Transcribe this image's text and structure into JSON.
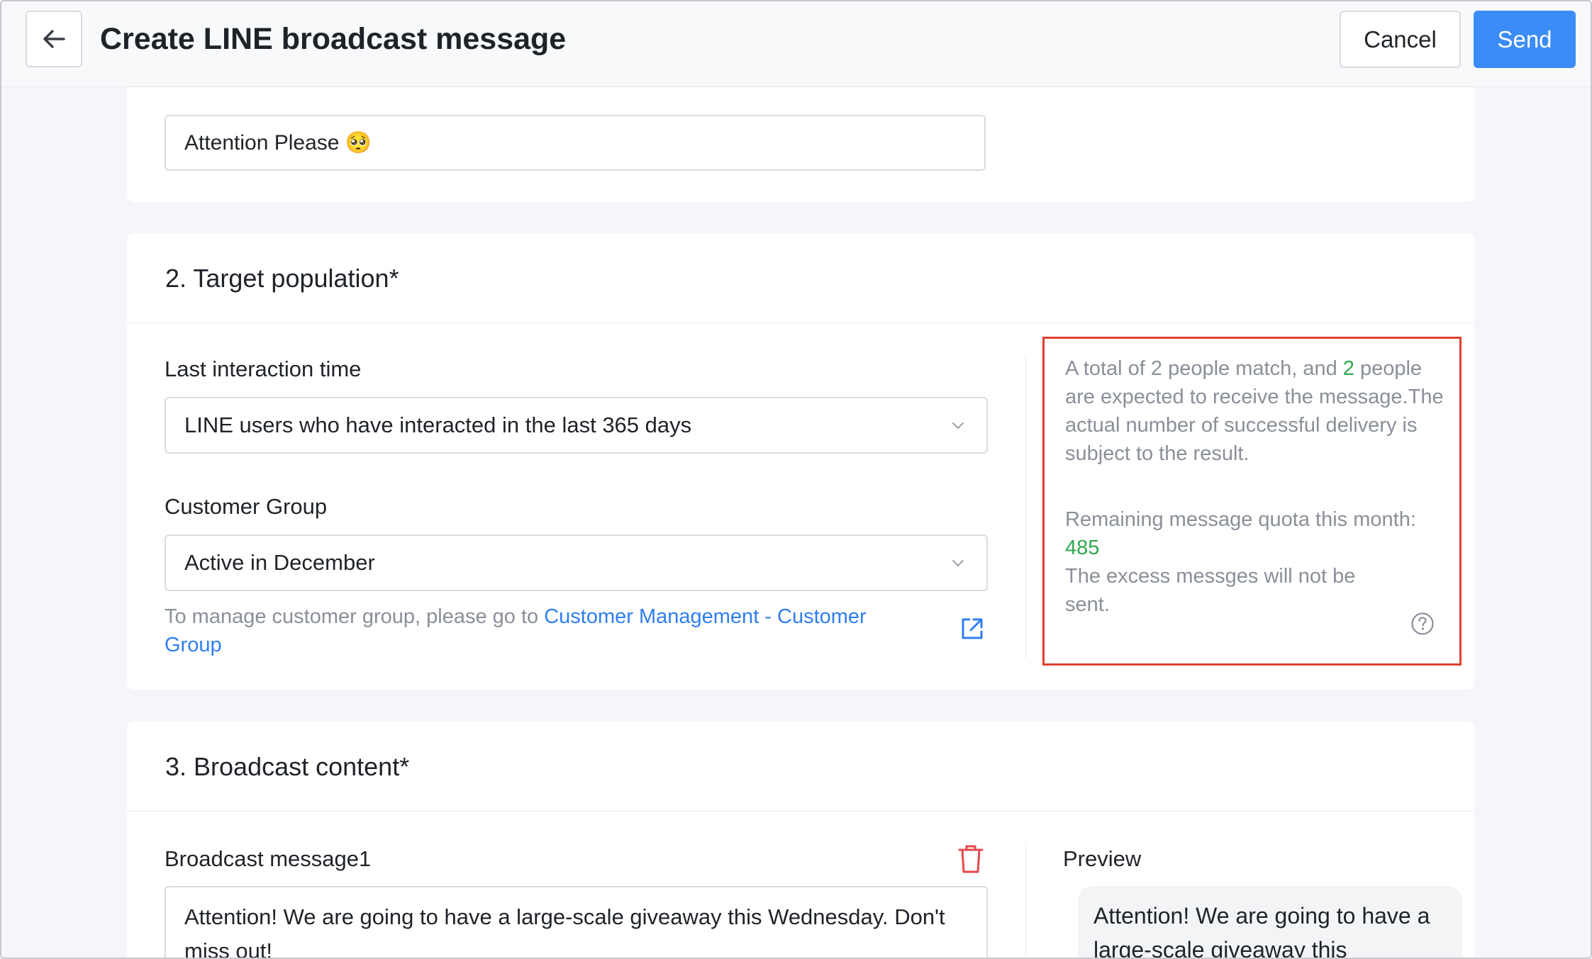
{
  "header": {
    "title": "Create LINE broadcast message",
    "cancel_label": "Cancel",
    "send_label": "Send"
  },
  "section1": {
    "title_value": "Attention Please 🥺"
  },
  "section2": {
    "title": "2. Target population*",
    "last_interaction_label": "Last interaction time",
    "last_interaction_value": "LINE users who have interacted in the last 365 days",
    "customer_group_label": "Customer Group",
    "customer_group_value": "Active in December",
    "hint_prefix": "To manage customer group, please go to ",
    "hint_link": "Customer Management - Customer Group",
    "info": {
      "match_prefix": "A total of 2 people match, and ",
      "expected_count": "2",
      "match_suffix": " people are expected to receive the message.The actual number of successful delivery is subject to the result.",
      "quota_label": "Remaining message quota this month:",
      "quota_value": "485",
      "excess_note": "The excess messges will not be sent."
    }
  },
  "section3": {
    "title": "3. Broadcast content*",
    "message_label": "Broadcast message1",
    "message_text": "Attention! We are going to have a large-scale giveaway this Wednesday. Don't miss out!",
    "preview_label": "Preview",
    "preview_text": "Attention! We are going to have a large-scale giveaway this Wednesday. Don't miss out!"
  },
  "colors": {
    "primary": "#3c8cf7",
    "link": "#2f7ef0",
    "highlight_border": "#e0402f",
    "success": "#2fa84f",
    "danger": "#e5484d"
  },
  "icons": [
    "arrow-left-icon",
    "chevron-down-icon",
    "external-link-icon",
    "question-circle-icon",
    "trash-icon"
  ]
}
